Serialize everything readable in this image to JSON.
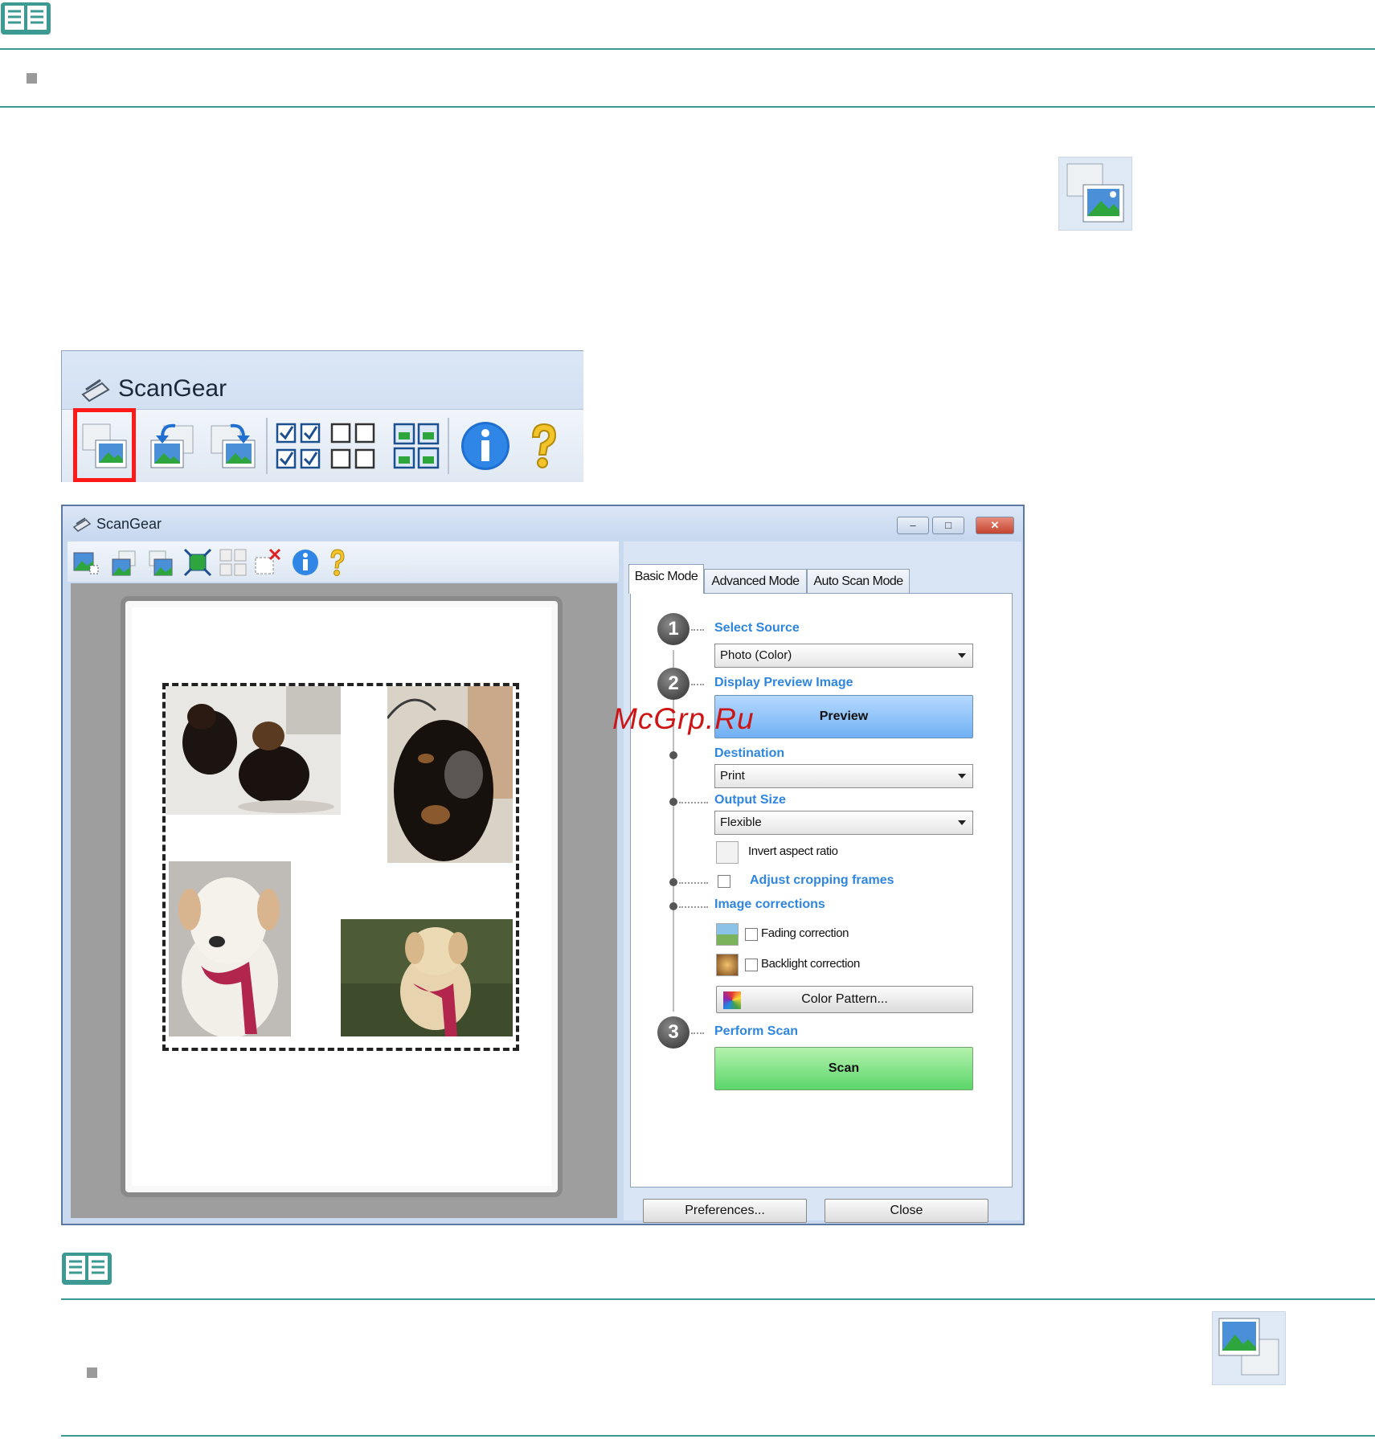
{
  "app": {
    "title": "ScanGear",
    "window_title": "ScanGear"
  },
  "tabs": [
    {
      "label": "Basic Mode"
    },
    {
      "label": "Advanced Mode"
    },
    {
      "label": "Auto Scan Mode"
    }
  ],
  "steps": {
    "step1": {
      "number": "1",
      "label": "Select Source",
      "select_value": "Photo (Color)"
    },
    "step2": {
      "number": "2",
      "label": "Display Preview Image",
      "button": "Preview"
    },
    "destination": {
      "label": "Destination",
      "select_value": "Print"
    },
    "output_size": {
      "label": "Output Size",
      "select_value": "Flexible",
      "invert_label": "Invert aspect ratio"
    },
    "adjust": {
      "label": "Adjust cropping frames"
    },
    "corrections": {
      "label": "Image corrections",
      "fading": "Fading correction",
      "backlight": "Backlight correction",
      "color_pattern": "Color Pattern..."
    },
    "step3": {
      "number": "3",
      "label": "Perform Scan",
      "button": "Scan"
    }
  },
  "bottom_buttons": {
    "preferences": "Preferences...",
    "close": "Close"
  },
  "window_controls": {
    "minimize": "–",
    "maximize": "□",
    "close": "✕"
  },
  "watermark": "McGrp.Ru",
  "colors": {
    "accent_rule": "#3c9a93",
    "label_blue": "#2f86df",
    "preview_button": "#6fb0f3",
    "scan_button": "#5bd66a",
    "highlight_red": "#ff1a1a"
  }
}
